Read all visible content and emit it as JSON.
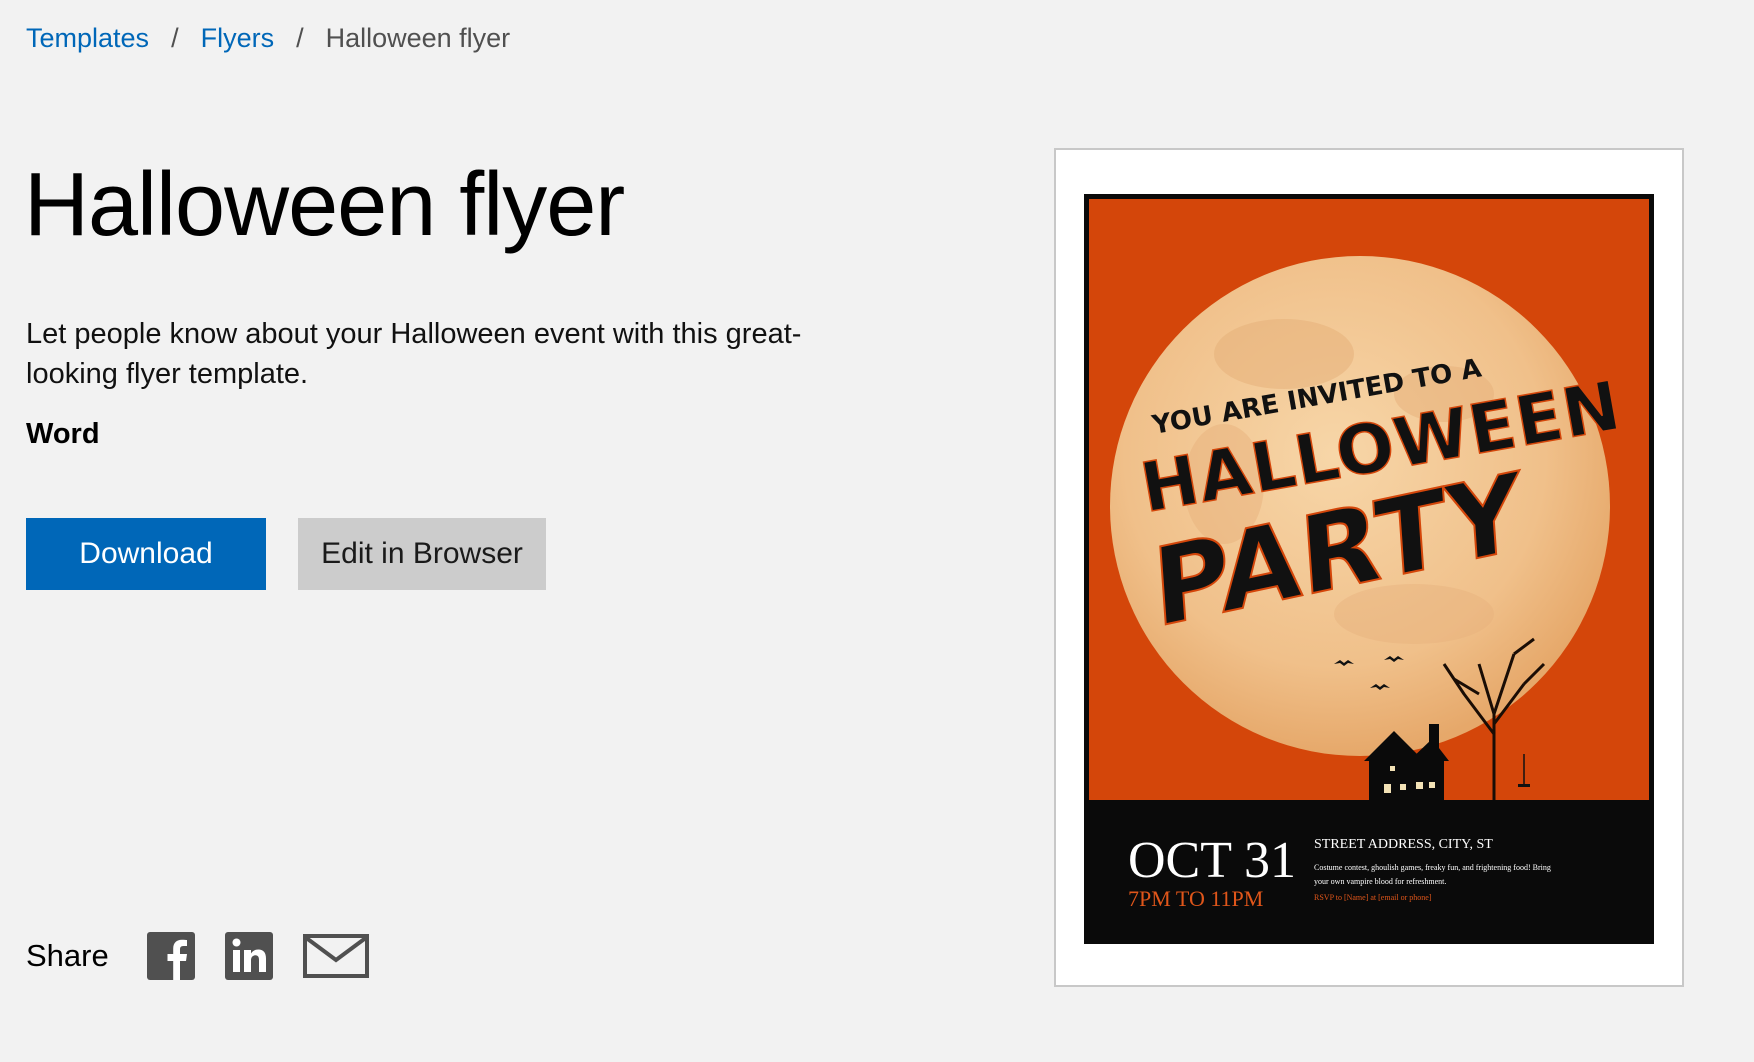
{
  "breadcrumb": {
    "items": [
      "Templates",
      "Flyers"
    ],
    "current": "Halloween flyer"
  },
  "page": {
    "title": "Halloween flyer",
    "description": "Let people know about your Halloween event with this great-looking flyer template.",
    "app": "Word"
  },
  "actions": {
    "download_label": "Download",
    "edit_label": "Edit in Browser"
  },
  "share": {
    "label": "Share",
    "icons": [
      "facebook-icon",
      "linkedin-icon",
      "email-icon"
    ]
  },
  "preview": {
    "line1": "YOU ARE INVITED TO A",
    "line2": "HALLOWEEN",
    "line3": "PARTY",
    "date": "OCT 31",
    "time": "7PM TO 11PM",
    "address": "STREET ADDRESS, CITY, ST",
    "details_1": "Costume contest, ghoulish games, freaky fun, and frightening food! Bring",
    "details_2": "your own vampire blood for refreshment.",
    "rsvp": "RSVP to [Name] at [email or phone]"
  },
  "colors": {
    "link": "#0067b8",
    "download_bg": "#0067b8",
    "edit_bg": "#cccccc",
    "page_bg": "#f2f2f2",
    "flyer_orange": "#d4460a",
    "moon": "#f3c892",
    "flyer_footer": "#0a0a0a",
    "flyer_time": "#e0561a"
  }
}
